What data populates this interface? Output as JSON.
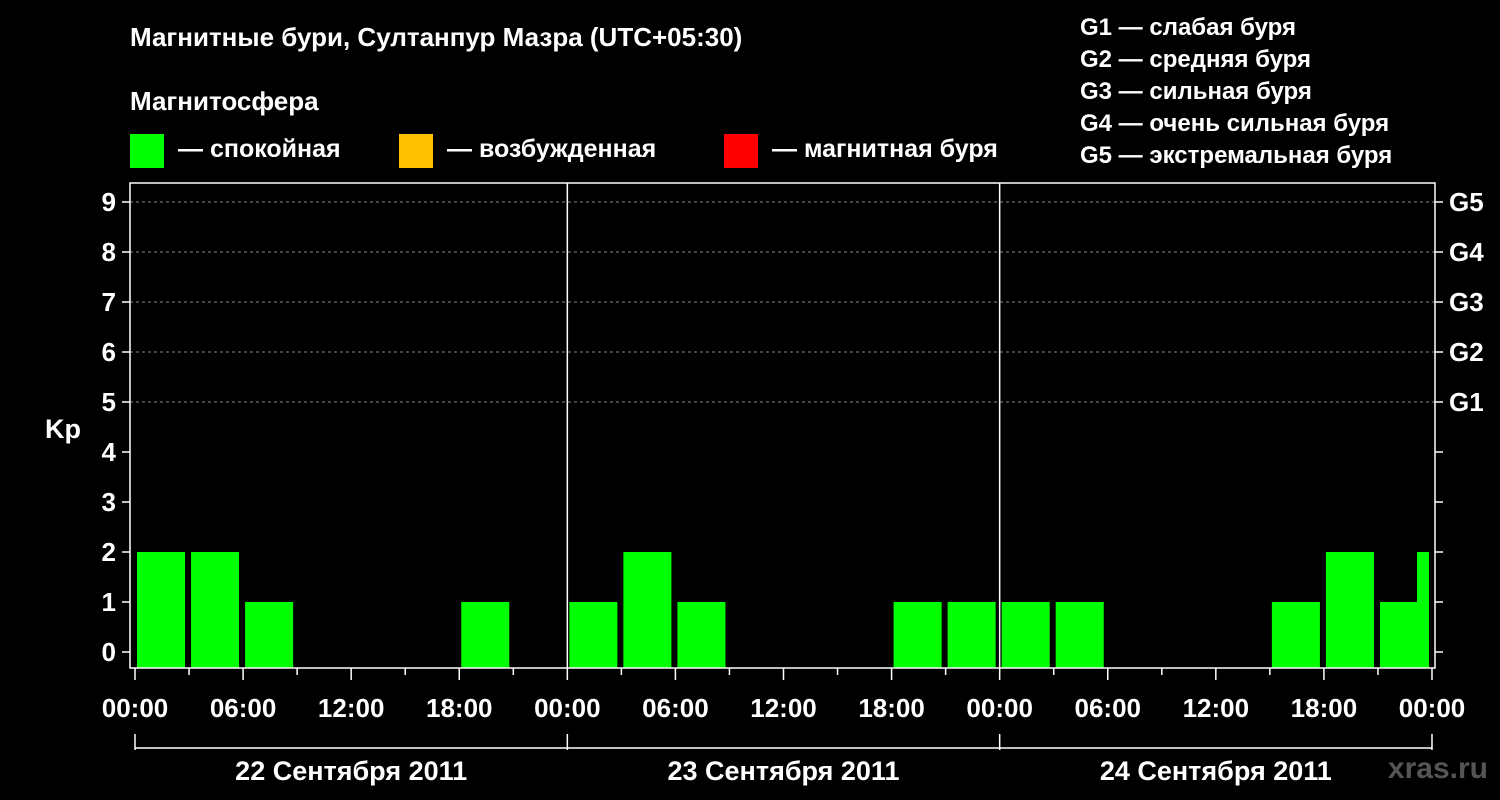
{
  "title": "Магнитные бури, Султанпур Мазра (UTC+05:30)",
  "subtitle": "Магнитосфера",
  "legend": [
    {
      "label": "— спокойная",
      "color": "#00ff00"
    },
    {
      "label": "— возбужденная",
      "color": "#ffc000"
    },
    {
      "label": "— магнитная буря",
      "color": "#ff0000"
    }
  ],
  "g_scale": [
    "G1 — слабая буря",
    "G2 — средняя буря",
    "G3 — сильная буря",
    "G4 — очень сильная буря",
    "G5 — экстремальная буря"
  ],
  "watermark": "xras.ru",
  "chart_data": {
    "type": "bar",
    "ylabel": "Kp",
    "ylim": [
      0,
      9
    ],
    "y_ticks": [
      "0",
      "1",
      "2",
      "3",
      "4",
      "5",
      "6",
      "7",
      "8",
      "9"
    ],
    "right_ticks": [
      {
        "kp": 5,
        "label": "G1"
      },
      {
        "kp": 6,
        "label": "G2"
      },
      {
        "kp": 7,
        "label": "G3"
      },
      {
        "kp": 8,
        "label": "G4"
      },
      {
        "kp": 9,
        "label": "G5"
      }
    ],
    "x_tick_labels": [
      "00:00",
      "06:00",
      "12:00",
      "18:00",
      "00:00",
      "06:00",
      "12:00",
      "18:00",
      "00:00",
      "06:00",
      "12:00",
      "18:00",
      "00:00"
    ],
    "days": [
      "22 Сентября 2011",
      "23 Сентября 2011",
      "24 Сентября 2011"
    ],
    "interval_hours": 3,
    "series": [
      {
        "values": [
          2,
          2,
          1,
          0,
          0,
          0,
          1,
          0,
          1,
          2,
          1,
          0,
          0,
          0,
          1,
          1,
          1,
          1,
          0,
          0,
          0,
          1,
          2,
          1
        ],
        "color": "#00ff00"
      }
    ],
    "partial_last": {
      "value": 2,
      "color": "#00ff00"
    },
    "grid": "dashed horizontal"
  }
}
